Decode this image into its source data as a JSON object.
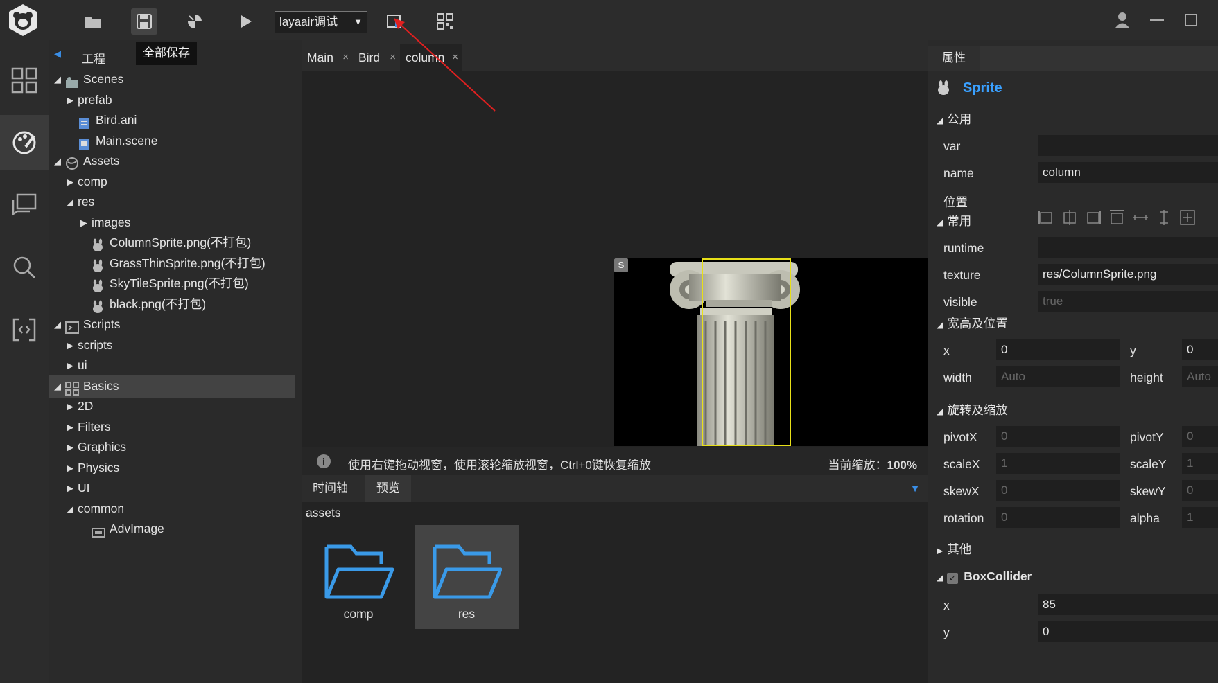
{
  "toolbar": {
    "config_select": "layaair调试",
    "save_all_tooltip": "全部保存"
  },
  "project": {
    "title": "工程",
    "tree": [
      {
        "label": "Scenes",
        "indent": 0,
        "expanded": true,
        "icon": "scene-folder-icon"
      },
      {
        "label": "prefab",
        "indent": 1,
        "expanded": false,
        "icon": ""
      },
      {
        "label": "Bird.ani",
        "indent": 1,
        "icon": "animation-file-icon"
      },
      {
        "label": "Main.scene",
        "indent": 1,
        "icon": "scene-file-icon"
      },
      {
        "label": "Assets",
        "indent": 0,
        "expanded": true,
        "icon": "assets-globe-icon"
      },
      {
        "label": "comp",
        "indent": 1,
        "expanded": false,
        "icon": ""
      },
      {
        "label": "res",
        "indent": 1,
        "expanded": true,
        "icon": ""
      },
      {
        "label": "images",
        "indent": 2,
        "expanded": false,
        "icon": ""
      },
      {
        "label": "ColumnSprite.png(不打包)",
        "indent": 2,
        "icon": "sprite-icon"
      },
      {
        "label": "GrassThinSprite.png(不打包)",
        "indent": 2,
        "icon": "sprite-icon"
      },
      {
        "label": "SkyTileSprite.png(不打包)",
        "indent": 2,
        "icon": "sprite-icon"
      },
      {
        "label": "black.png(不打包)",
        "indent": 2,
        "icon": "sprite-icon"
      },
      {
        "label": "Scripts",
        "indent": 0,
        "expanded": true,
        "icon": "scripts-folder-icon"
      },
      {
        "label": "scripts",
        "indent": 1,
        "expanded": false,
        "icon": ""
      },
      {
        "label": "ui",
        "indent": 1,
        "expanded": false,
        "icon": ""
      },
      {
        "label": "Basics",
        "indent": 0,
        "expanded": true,
        "icon": "basics-grid-icon",
        "selected": true
      },
      {
        "label": "2D",
        "indent": 1,
        "expanded": false,
        "icon": ""
      },
      {
        "label": "Filters",
        "indent": 1,
        "expanded": false,
        "icon": ""
      },
      {
        "label": "Graphics",
        "indent": 1,
        "expanded": false,
        "icon": ""
      },
      {
        "label": "Physics",
        "indent": 1,
        "expanded": false,
        "icon": ""
      },
      {
        "label": "UI",
        "indent": 1,
        "expanded": false,
        "icon": ""
      },
      {
        "label": "common",
        "indent": 1,
        "expanded": true,
        "icon": ""
      },
      {
        "label": "AdvImage",
        "indent": 2,
        "icon": "image-component-icon"
      }
    ]
  },
  "editor": {
    "tabs": [
      {
        "label": "Main",
        "active": false
      },
      {
        "label": "Bird",
        "active": false
      },
      {
        "label": "column",
        "active": true
      }
    ],
    "close_glyph": "×",
    "stage_badge": "S",
    "hint": "使用右键拖动视窗，使用滚轮缩放视窗，Ctrl+0键恢复缩放",
    "zoom_label": "当前缩放：",
    "zoom_value": "100%"
  },
  "bottom": {
    "tabs": [
      "时间轴",
      "预览"
    ],
    "path": "assets",
    "folders": [
      {
        "name": "comp",
        "selected": false
      },
      {
        "name": "res",
        "selected": true
      }
    ]
  },
  "properties": {
    "header": "属性",
    "component": "Sprite",
    "sections": {
      "common": "公用",
      "usual": "常用",
      "size_pos": "宽高及位置",
      "rot_scale": "旋转及缩放",
      "other": "其他",
      "collider": "BoxCollider"
    },
    "fields": {
      "var_label": "var",
      "var_value": "",
      "name_label": "name",
      "name_value": "column",
      "pos_label": "位置",
      "runtime_label": "runtime",
      "runtime_value": "",
      "texture_label": "texture",
      "texture_value": "res/ColumnSprite.png",
      "visible_label": "visible",
      "visible_value": "true",
      "x_label": "x",
      "x_value": "0",
      "y_label": "y",
      "y_value": "0",
      "width_label": "width",
      "width_value": "Auto",
      "height_label": "height",
      "height_value": "Auto",
      "pivotX_label": "pivotX",
      "pivotX_value": "0",
      "pivotY_label": "pivotY",
      "pivotY_value": "0",
      "scaleX_label": "scaleX",
      "scaleX_value": "1",
      "scaleY_label": "scaleY",
      "scaleY_value": "1",
      "skewX_label": "skewX",
      "skewX_value": "0",
      "skewY_label": "skewY",
      "skewY_value": "0",
      "rotation_label": "rotation",
      "rotation_value": "0",
      "alpha_label": "alpha",
      "alpha_value": "1",
      "collider_x_label": "x",
      "collider_x_value": "85",
      "collider_y_label": "y",
      "collider_y_value": "0"
    }
  },
  "colors": {
    "accent_blue": "#3aa0ff",
    "selection_yellow": "#e8e018",
    "arrow_red": "#e02020"
  }
}
